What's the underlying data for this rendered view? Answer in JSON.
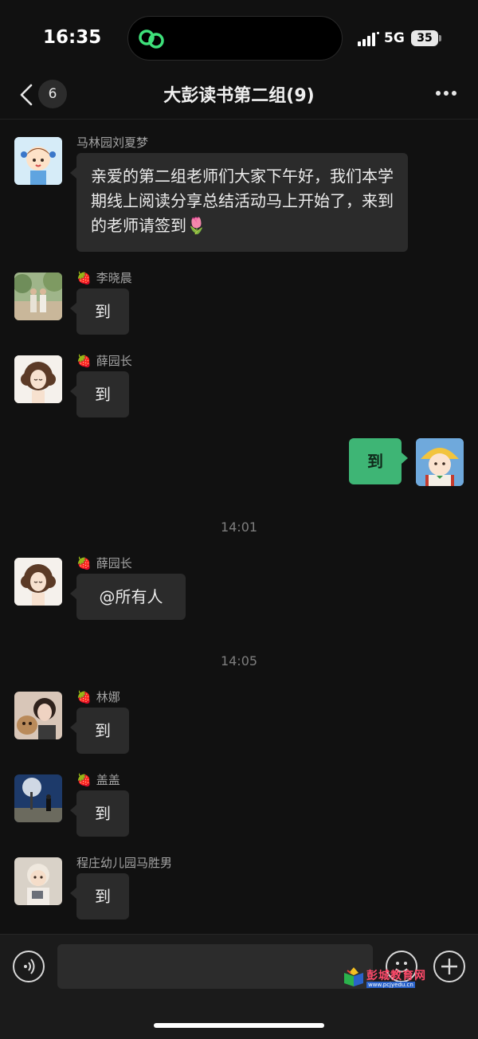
{
  "status_bar": {
    "time": "16:35",
    "network": "5G",
    "battery": "35",
    "island_icon": "link-icon"
  },
  "nav": {
    "back_badge": "6",
    "title": "大彭读书第二组(9)",
    "more_icon": "more-icon"
  },
  "messages": [
    {
      "sender": "马林园刘夏梦",
      "tag": "",
      "text": "亲爱的第二组老师们大家下午好，我们本学期线上阅读分享总结活动马上开始了，来到的老师请签到",
      "emoji": "🌷",
      "avatar": "avatar-cartoon-girl"
    },
    {
      "sender": "李晓晨",
      "tag": "🍓",
      "text": "到",
      "avatar": "avatar-photo-couple"
    },
    {
      "sender": "薛园长",
      "tag": "🍓",
      "text": "到",
      "avatar": "avatar-curly-hair-woman"
    },
    {
      "sender": "",
      "tag": "",
      "text": "到",
      "avatar": "avatar-cartoon-boy",
      "self": true
    },
    {
      "timestamp": "14:01"
    },
    {
      "sender": "薛园长",
      "tag": "🍓",
      "text": "@所有人",
      "avatar": "avatar-curly-hair-woman"
    },
    {
      "timestamp": "14:05"
    },
    {
      "sender": "林娜",
      "tag": "🍓",
      "text": "到",
      "avatar": "avatar-photo-woman-dog"
    },
    {
      "sender": "盖盖",
      "tag": "🍓",
      "text": "到",
      "avatar": "avatar-photo-night-tree"
    },
    {
      "sender": "程庄幼儿园马胜男",
      "tag": "",
      "text": "到",
      "avatar": "avatar-photo-baby"
    }
  ],
  "input_bar": {
    "voice_icon": "voice-icon",
    "emoji_icon": "emoji-icon",
    "plus_icon": "plus-icon"
  },
  "watermark": {
    "name": "彭城教育网",
    "url": "www.pcjyedu.cn"
  },
  "colors": {
    "background": "#111111",
    "bubble": "#2b2b2b",
    "self_bubble": "#3eb575",
    "timestamp": "#7d7d7d"
  }
}
